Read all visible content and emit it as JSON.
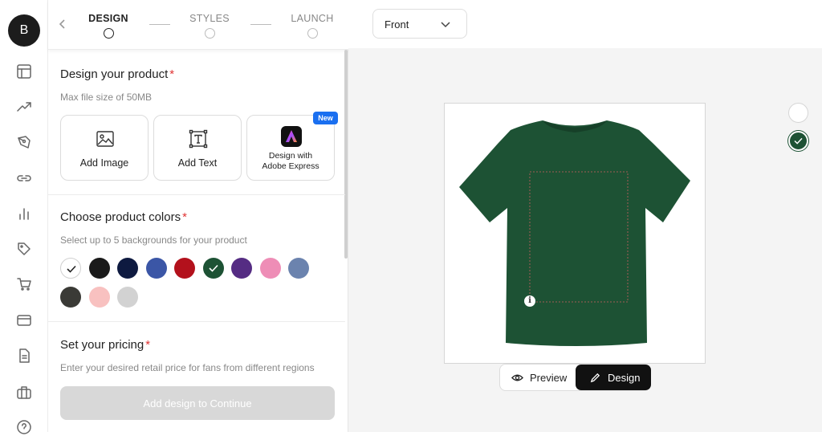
{
  "user": {
    "initial": "B"
  },
  "rail_icons": [
    "layout-icon",
    "trend-icon",
    "pen-tool-icon",
    "link-icon",
    "bar-chart-icon",
    "tag-icon",
    "cart-icon",
    "card-icon",
    "document-icon",
    "briefcase-icon",
    "help-icon"
  ],
  "steps": [
    {
      "label": "DESIGN",
      "active": true
    },
    {
      "label": "STYLES",
      "active": false
    },
    {
      "label": "LAUNCH",
      "active": false
    }
  ],
  "design": {
    "title": "Design your product",
    "required": "*",
    "subtitle": "Max file size of 50MB",
    "add_image": "Add Image",
    "add_text": "Add Text",
    "adobe_line1": "Design with",
    "adobe_line2": "Adobe Express",
    "new_badge": "New"
  },
  "colors_section": {
    "title": "Choose product colors",
    "required": "*",
    "subtitle": "Select up to 5 backgrounds for your product",
    "swatches": [
      {
        "color": "#ffffff",
        "selected": true
      },
      {
        "color": "#1a1a1a",
        "selected": false
      },
      {
        "color": "#0e1a40",
        "selected": false
      },
      {
        "color": "#3b56a6",
        "selected": false
      },
      {
        "color": "#b3111c",
        "selected": false
      },
      {
        "color": "#1d5234",
        "selected": true
      },
      {
        "color": "#552c83",
        "selected": false
      },
      {
        "color": "#ee8db6",
        "selected": false
      },
      {
        "color": "#6b83ae",
        "selected": false
      },
      {
        "color": "#3a3a36",
        "selected": false
      },
      {
        "color": "#f8c1c0",
        "selected": false
      },
      {
        "color": "#d2d2d2",
        "selected": false
      }
    ]
  },
  "pricing": {
    "title": "Set your pricing",
    "required": "*",
    "subtitle": "Enter your desired retail price for fans from different regions"
  },
  "continue_label": "Add design to Continue",
  "view": {
    "selected": "Front"
  },
  "toggle": {
    "preview": "Preview",
    "design": "Design"
  },
  "shirt_color": "#1d5234",
  "side_swatches": [
    {
      "color": "#ffffff",
      "selected": false
    },
    {
      "color": "#1d5234",
      "selected": true
    }
  ]
}
